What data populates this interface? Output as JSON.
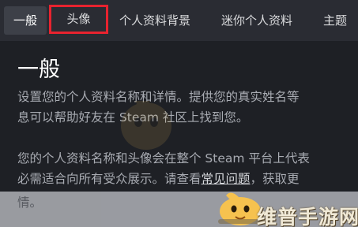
{
  "tabs": [
    {
      "label": "一般"
    },
    {
      "label": "头像"
    },
    {
      "label": "个人资料背景"
    },
    {
      "label": "迷你个人资料"
    },
    {
      "label": "主题"
    }
  ],
  "section": {
    "title": "一般",
    "intro": [
      "设置您的个人资料名称和详情。提供您的真实姓名等",
      "息可以帮助好友在 Steam 社区上找到您。"
    ],
    "notice_line1": "您的个人资料名称和头像会在整个 Steam 平台上代表",
    "notice_line2_start": "必需适合向所有受众展示。请查看",
    "faq_link": "常见问题",
    "notice_line2_end": "，获取更",
    "notice_line3": "情。"
  },
  "watermark": {
    "text": "维普手游网"
  },
  "colors": {
    "tab_highlight_border": "#e8232f",
    "background": "#1d1f24"
  }
}
